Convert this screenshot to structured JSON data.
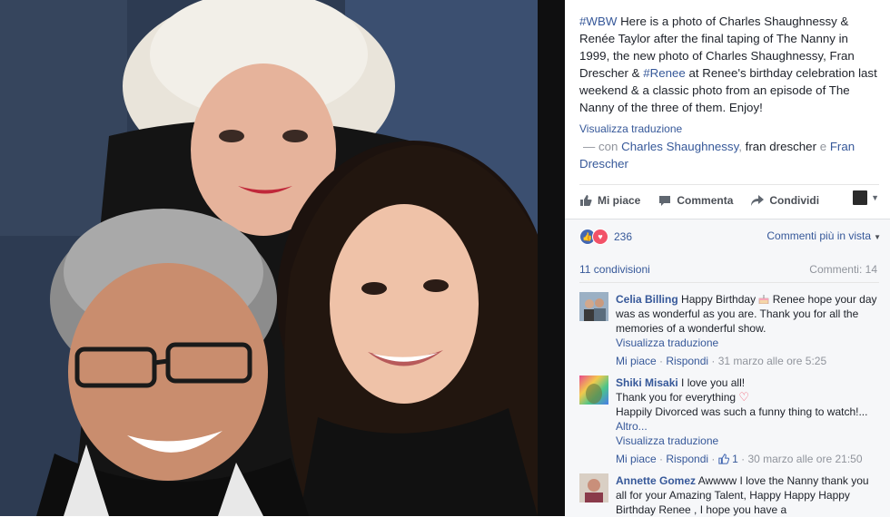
{
  "post": {
    "tag_wbw": "#WBW",
    "text_1": " Here is a photo of Charles Shaughnessy & Renée Taylor after the final taping of The Nanny in 1999, the new photo of Charles Shaughnessy, Fran Drescher & ",
    "tag_renee": "#Renee",
    "text_2": " at Renee's birthday celebration last weekend & a classic photo from an episode of The Nanny of the three of them. Enjoy!",
    "see_translation": "Visualizza traduzione",
    "with_prefix": "— con",
    "with_person_1": "Charles Shaughnessy",
    "with_sep_1": ",",
    "with_person_2": "fran drescher",
    "with_sep_2": "e",
    "with_person_3": "Fran Drescher"
  },
  "actions": {
    "like": "Mi piace",
    "comment": "Commenta",
    "share": "Condividi"
  },
  "stats": {
    "reactions_count": "236",
    "sort_label": "Commenti più in vista",
    "shares": "11 condivisioni",
    "comments_count": "Commenti: 14"
  },
  "comments": [
    {
      "author": "Celia Billing",
      "text_a": "Happy Birthday",
      "text_b": "Renee hope your day was as wonderful as you are. Thank you for all the memories of a wonderful show.",
      "translate": "Visualizza traduzione",
      "like": "Mi piace",
      "reply": "Rispondi",
      "time": "31 marzo alle ore 5:25"
    },
    {
      "author": "Shiki Misaki",
      "line1": "I love you all!",
      "line2": "Thank you for everything",
      "line3": "Happily Divorced was such a funny thing to watch!...",
      "more": "Altro...",
      "translate": "Visualizza traduzione",
      "like": "Mi piace",
      "reply": "Rispondi",
      "likes": "1",
      "time": "30 marzo alle ore 21:50"
    },
    {
      "author": "Annette Gomez",
      "text": "Awwww I love the Nanny thank you all for your Amazing Talent, Happy Happy Happy Birthday Renee , I hope you have a"
    }
  ],
  "colors": {
    "link": "#365899",
    "muted": "#90949c",
    "like_blue": "#4267b2",
    "love_red": "#f25268"
  }
}
